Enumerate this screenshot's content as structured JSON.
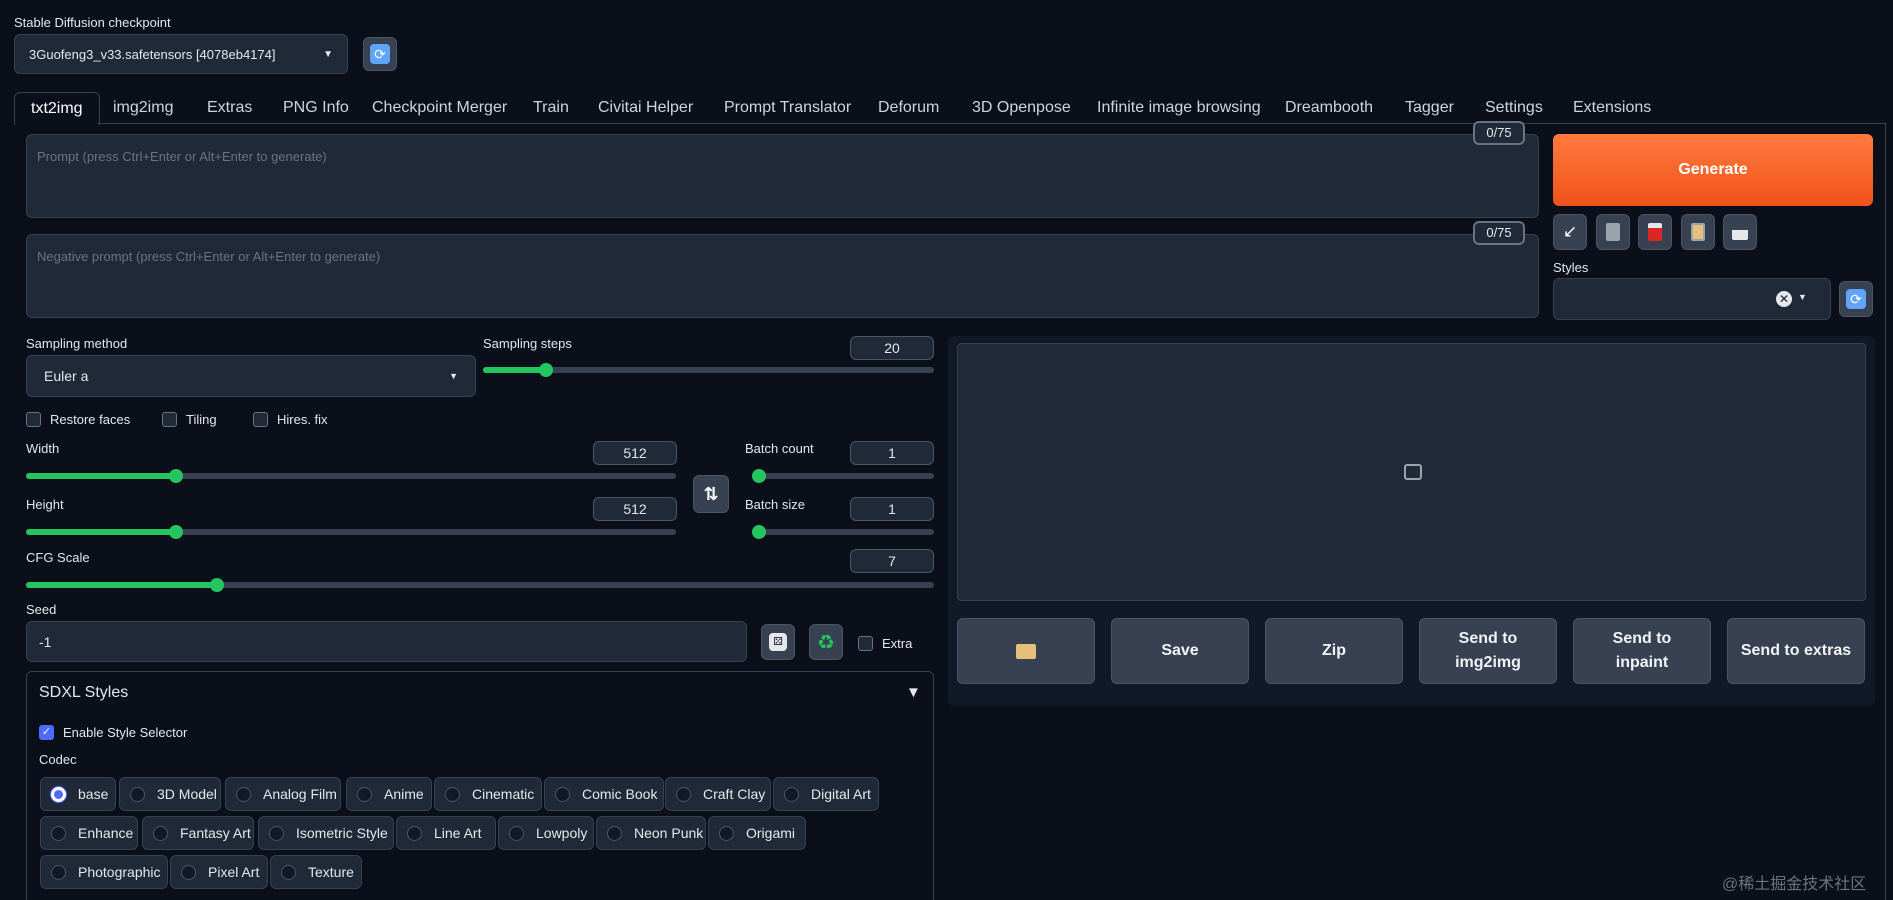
{
  "checkpoint": {
    "label": "Stable Diffusion checkpoint",
    "value": "3Guofeng3_v33.safetensors [4078eb4174]"
  },
  "tabs": [
    {
      "label": "txt2img",
      "active": true
    },
    {
      "label": "img2img"
    },
    {
      "label": "Extras"
    },
    {
      "label": "PNG Info"
    },
    {
      "label": "Checkpoint Merger"
    },
    {
      "label": "Train"
    },
    {
      "label": "Civitai Helper"
    },
    {
      "label": "Prompt Translator"
    },
    {
      "label": "Deforum"
    },
    {
      "label": "3D Openpose"
    },
    {
      "label": "Infinite image browsing"
    },
    {
      "label": "Dreambooth"
    },
    {
      "label": "Tagger"
    },
    {
      "label": "Settings"
    },
    {
      "label": "Extensions"
    }
  ],
  "prompt": {
    "placeholder": "Prompt (press Ctrl+Enter or Alt+Enter to generate)",
    "counter": "0/75"
  },
  "negative_prompt": {
    "placeholder": "Negative prompt (press Ctrl+Enter or Alt+Enter to generate)",
    "counter": "0/75"
  },
  "generate_label": "Generate",
  "styles_label": "Styles",
  "sampling_method": {
    "label": "Sampling method",
    "value": "Euler a"
  },
  "sampling_steps": {
    "label": "Sampling steps",
    "value": "20",
    "fraction": 0.14
  },
  "checkboxes": {
    "restore_faces": "Restore faces",
    "tiling": "Tiling",
    "hires_fix": "Hires. fix"
  },
  "width": {
    "label": "Width",
    "value": "512",
    "fraction": 0.23
  },
  "height": {
    "label": "Height",
    "value": "512",
    "fraction": 0.23
  },
  "batch_count": {
    "label": "Batch count",
    "value": "1",
    "fraction": 0.0
  },
  "batch_size": {
    "label": "Batch size",
    "value": "1",
    "fraction": 0.0
  },
  "cfg_scale": {
    "label": "CFG Scale",
    "value": "7",
    "fraction": 0.21
  },
  "seed": {
    "label": "Seed",
    "value": "-1",
    "extra_label": "Extra"
  },
  "output_buttons": {
    "save": "Save",
    "zip": "Zip",
    "send_img2img": "Send to img2img",
    "send_inpaint": "Send to inpaint",
    "send_extras": "Send to extras"
  },
  "sdxl": {
    "title": "SDXL Styles",
    "enable_label": "Enable Style Selector",
    "codec_label": "Codec",
    "styles": [
      "base",
      "3D Model",
      "Analog Film",
      "Anime",
      "Cinematic",
      "Comic Book",
      "Craft Clay",
      "Digital Art",
      "Enhance",
      "Fantasy Art",
      "Isometric Style",
      "Line Art",
      "Lowpoly",
      "Neon Punk",
      "Origami",
      "Photographic",
      "Pixel Art",
      "Texture"
    ],
    "selected": "base"
  },
  "watermark": "@稀土掘金技术社区",
  "colors": {
    "accent": "#ff6b2b",
    "slider": "#22c55e",
    "radio_selected": "#4f6bff"
  }
}
